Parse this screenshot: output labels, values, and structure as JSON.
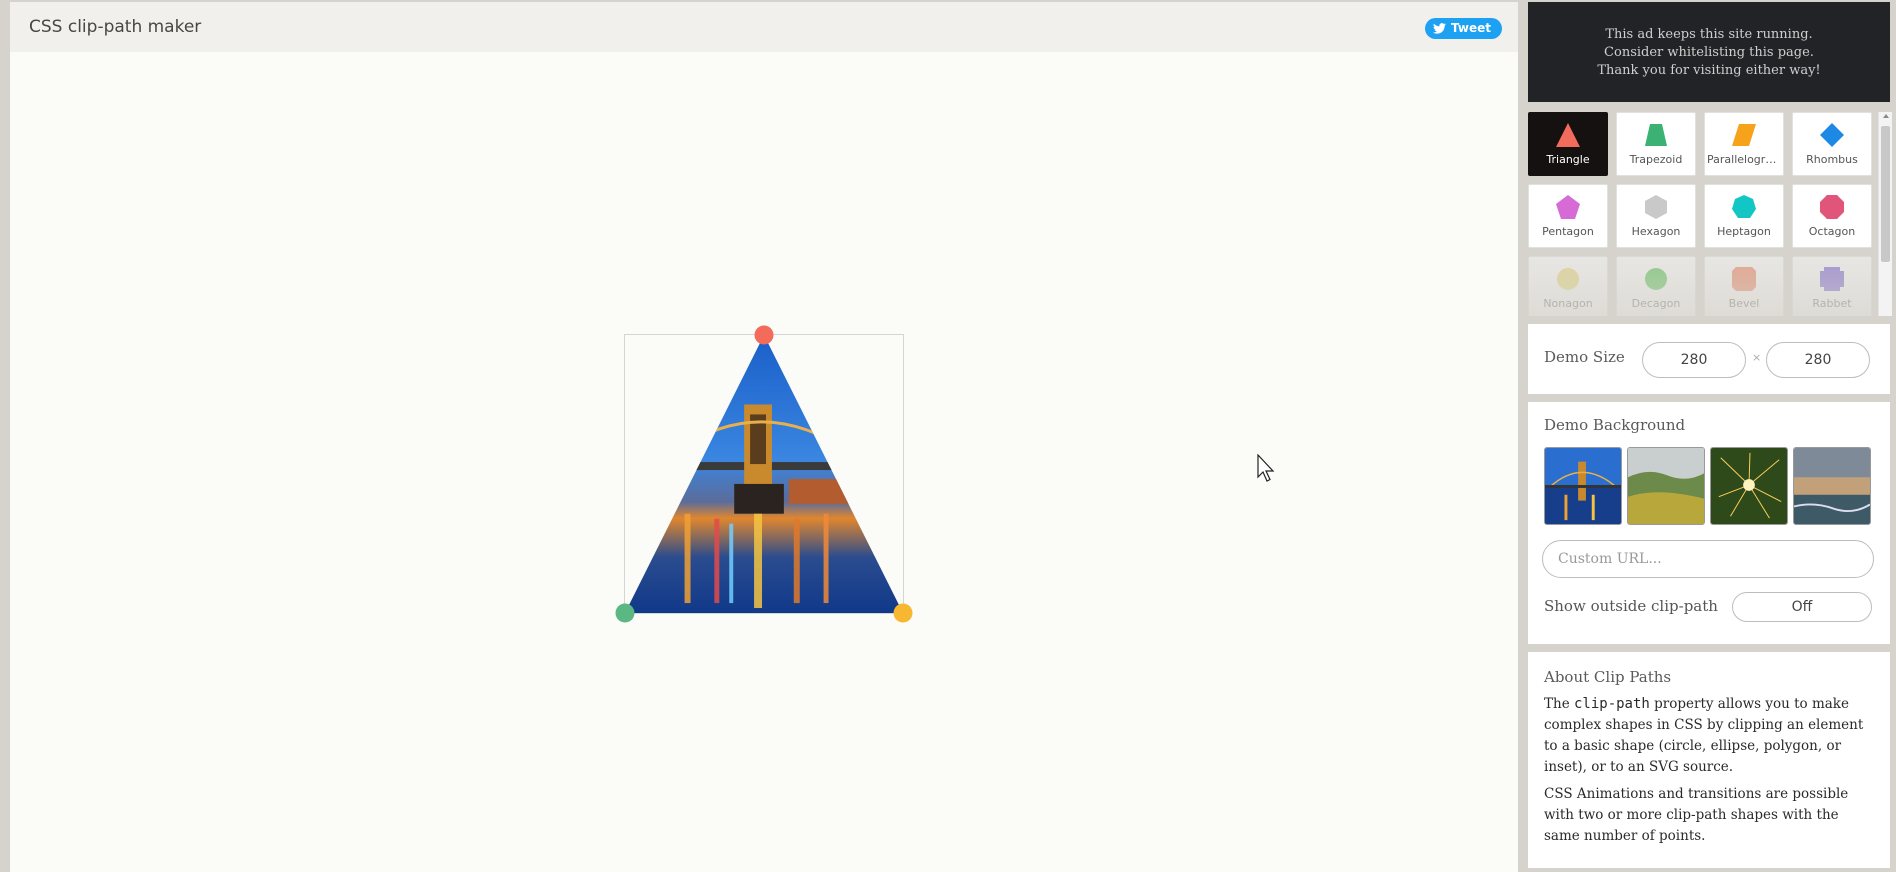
{
  "app": {
    "title": "CSS clip-path maker"
  },
  "header": {
    "tweet_label": "Tweet"
  },
  "ad": {
    "line1": "This ad keeps this site running.",
    "line2": "Consider whitelisting this page.",
    "line3": "Thank you for visiting either way!"
  },
  "shapes": [
    {
      "label": "Triangle",
      "color": "#f26b5b",
      "icon": "triangle-icon",
      "active": true
    },
    {
      "label": "Trapezoid",
      "color": "#3bb273",
      "icon": "trapezoid-icon"
    },
    {
      "label": "Parallelogra...",
      "color": "#f7a21b",
      "icon": "parallelogram-icon"
    },
    {
      "label": "Rhombus",
      "color": "#1e88e5",
      "icon": "rhombus-icon"
    },
    {
      "label": "Pentagon",
      "color": "#d66ad6",
      "icon": "pentagon-icon"
    },
    {
      "label": "Hexagon",
      "color": "#c9c9c9",
      "icon": "hexagon-icon"
    },
    {
      "label": "Heptagon",
      "color": "#12c6c6",
      "icon": "heptagon-icon"
    },
    {
      "label": "Octagon",
      "color": "#e2557a",
      "icon": "octagon-icon"
    },
    {
      "label": "Nonagon",
      "color": "#e7d66a",
      "icon": "nonagon-icon"
    },
    {
      "label": "Decagon",
      "color": "#3fbf3f",
      "icon": "decagon-icon"
    },
    {
      "label": "Bevel",
      "color": "#f0734c",
      "icon": "bevel-icon"
    },
    {
      "label": "Rabbet",
      "color": "#6a4fd1",
      "icon": "rabbet-icon"
    }
  ],
  "demo_size": {
    "title": "Demo Size",
    "width": "280",
    "height": "280",
    "times": "×"
  },
  "demo_background": {
    "title": "Demo Background",
    "thumbnails": [
      "bridge-night",
      "green-hills",
      "sparkler",
      "seashore"
    ],
    "custom_url_placeholder": "Custom URL...",
    "show_outside_label": "Show outside clip-path",
    "show_outside_value": "Off"
  },
  "about": {
    "title": "About Clip Paths",
    "p1_before": "The ",
    "p1_code": "clip-path",
    "p1_after": " property allows you to make complex shapes in CSS by clipping an element to a basic shape (circle, ellipse, polygon, or inset), or to an SVG source.",
    "p2": "CSS Animations and transitions are possible with two or more clip-path shapes with the same number of points."
  },
  "handles": [
    {
      "name": "top-handle",
      "color": "#f26b5b"
    },
    {
      "name": "left-handle",
      "color": "#5bb882"
    },
    {
      "name": "right-handle",
      "color": "#f7b731"
    }
  ]
}
